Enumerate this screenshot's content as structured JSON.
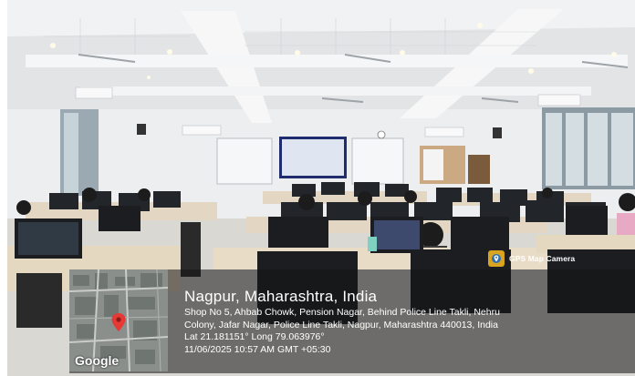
{
  "camera_badge": {
    "label": "GPS Map Camera",
    "icon": "map-pin-icon"
  },
  "map": {
    "logo": "Google",
    "marker_icon": "map-pin-icon"
  },
  "location": {
    "place": "Nagpur, Maharashtra, India",
    "address_line1": "Shop No 5, Ahbab Chowk, Pension Nagar, Behind Police Line Takli, Nehru",
    "address_line2": "Colony, Jafar Nagar, Police Line Takli, Nagpur, Maharashtra 440013, India",
    "coordinates": "Lat 21.181151° Long 79.063976°",
    "datetime": "11/06/2025 10:57 AM GMT +05:30"
  },
  "colors": {
    "overlay": "#141414",
    "badge": "#d9a520",
    "marker": "#e53935"
  }
}
